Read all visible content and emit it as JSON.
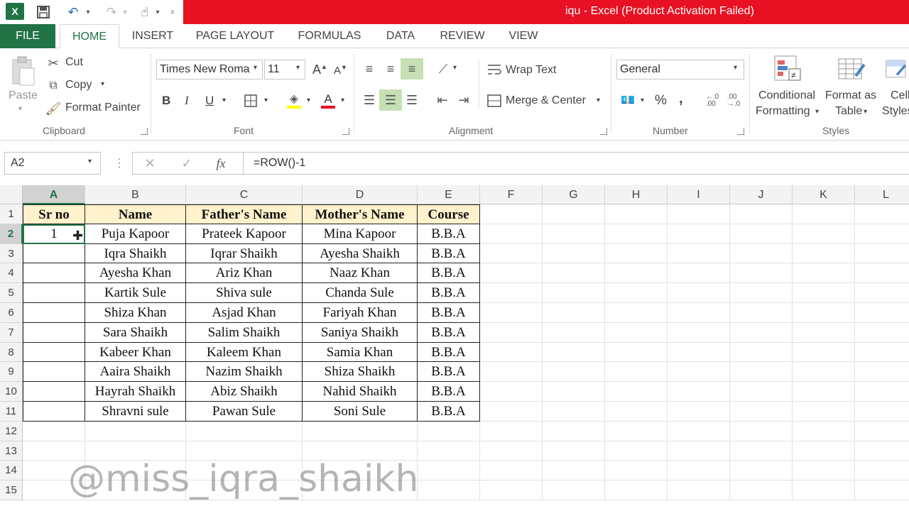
{
  "window": {
    "title": "iqu -  Excel (Product Activation Failed)"
  },
  "tabs": [
    "FILE",
    "HOME",
    "INSERT",
    "PAGE LAYOUT",
    "FORMULAS",
    "DATA",
    "REVIEW",
    "VIEW"
  ],
  "clipboard": {
    "paste": "Paste",
    "cut": "Cut",
    "copy": "Copy",
    "format_painter": "Format Painter",
    "label": "Clipboard"
  },
  "font": {
    "name": "Times New Roma",
    "size": "11",
    "bold": "B",
    "italic": "I",
    "underline": "U",
    "label": "Font"
  },
  "alignment": {
    "wrap_text": "Wrap Text",
    "merge_center": "Merge & Center",
    "label": "Alignment"
  },
  "number": {
    "format": "General",
    "percent": "%",
    "comma": "&#44;",
    "label": "Number"
  },
  "styles": {
    "conditional": "Conditional",
    "conditional2": "Formatting",
    "format_as": "Format as",
    "table": "Table",
    "cell": "Cell",
    "cell2": "Styles",
    "label": "Styles"
  },
  "formula_bar": {
    "name_box": "A2",
    "formula": "=ROW()-1",
    "fx": "fx"
  },
  "columns": [
    "A",
    "B",
    "C",
    "D",
    "E",
    "F",
    "G",
    "H",
    "I",
    "J",
    "K",
    "L"
  ],
  "rows": [
    "1",
    "2",
    "3",
    "4",
    "5",
    "6",
    "7",
    "8",
    "9",
    "10",
    "11",
    "12",
    "13",
    "14",
    "15"
  ],
  "table": {
    "headers": [
      "Sr no",
      "Name",
      "Father's Name",
      "Mother's Name",
      "Course"
    ],
    "data": [
      [
        "1",
        "Puja Kapoor",
        "Prateek Kapoor",
        "Mina Kapoor",
        "B.B.A"
      ],
      [
        "",
        "Iqra Shaikh",
        "Iqrar Shaikh",
        "Ayesha Shaikh",
        "B.B.A"
      ],
      [
        "",
        "Ayesha Khan",
        "Ariz Khan",
        "Naaz Khan",
        "B.B.A"
      ],
      [
        "",
        "Kartik Sule",
        "Shiva sule",
        "Chanda Sule",
        "B.B.A"
      ],
      [
        "",
        "Shiza Khan",
        "Asjad Khan",
        "Fariyah Khan",
        "B.B.A"
      ],
      [
        "",
        "Sara Shaikh",
        "Salim Shaikh",
        "Saniya Shaikh",
        "B.B.A"
      ],
      [
        "",
        "Kabeer Khan",
        "Kaleem Khan",
        "Samia Khan",
        "B.B.A"
      ],
      [
        "",
        "Aaira Shaikh",
        "Nazim Shaikh",
        "Shiza Shaikh",
        "B.B.A"
      ],
      [
        "",
        "Hayrah Shaikh",
        "Abiz Shaikh",
        "Nahid Shaikh",
        "B.B.A"
      ],
      [
        "",
        "Shravni sule",
        "Pawan Sule",
        "Soni Sule",
        "B.B.A"
      ]
    ]
  },
  "watermark": "@miss_iqra_shaikh",
  "colors": {
    "accent": "#217346",
    "titlebar": "#e81123",
    "header_fill": "#fff2cc"
  }
}
